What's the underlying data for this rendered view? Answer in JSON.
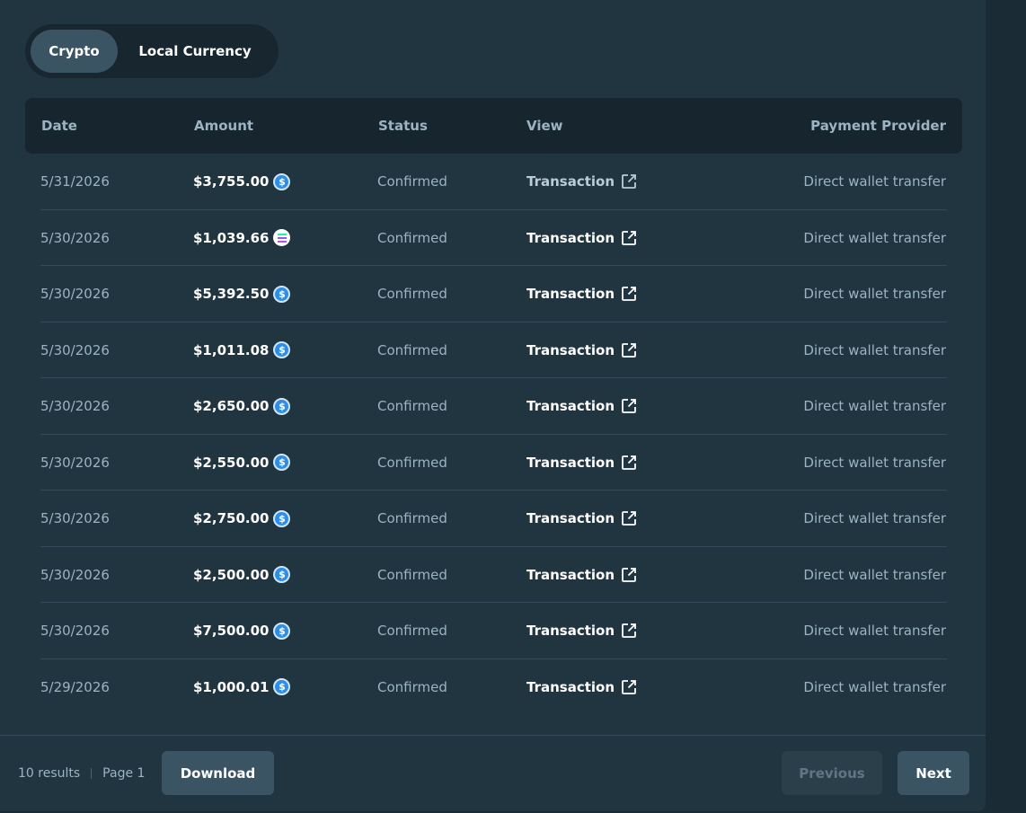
{
  "toggle": {
    "crypto_label": "Crypto",
    "local_label": "Local Currency"
  },
  "table": {
    "headers": {
      "date": "Date",
      "amount": "Amount",
      "status": "Status",
      "view": "View",
      "provider": "Payment Provider"
    },
    "rows": [
      {
        "date": "5/31/2026",
        "amount": "$3,755.00",
        "coin": "usdc-icon",
        "status": "Confirmed",
        "view": "Transaction",
        "provider": "Direct wallet transfer"
      },
      {
        "date": "5/30/2026",
        "amount": "$1,039.66",
        "coin": "solana-icon",
        "status": "Confirmed",
        "view": "Transaction",
        "provider": "Direct wallet transfer"
      },
      {
        "date": "5/30/2026",
        "amount": "$5,392.50",
        "coin": "usdc-icon",
        "status": "Confirmed",
        "view": "Transaction",
        "provider": "Direct wallet transfer"
      },
      {
        "date": "5/30/2026",
        "amount": "$1,011.08",
        "coin": "usdc-icon",
        "status": "Confirmed",
        "view": "Transaction",
        "provider": "Direct wallet transfer"
      },
      {
        "date": "5/30/2026",
        "amount": "$2,650.00",
        "coin": "usdc-icon",
        "status": "Confirmed",
        "view": "Transaction",
        "provider": "Direct wallet transfer"
      },
      {
        "date": "5/30/2026",
        "amount": "$2,550.00",
        "coin": "usdc-icon",
        "status": "Confirmed",
        "view": "Transaction",
        "provider": "Direct wallet transfer"
      },
      {
        "date": "5/30/2026",
        "amount": "$2,750.00",
        "coin": "usdc-icon",
        "status": "Confirmed",
        "view": "Transaction",
        "provider": "Direct wallet transfer"
      },
      {
        "date": "5/30/2026",
        "amount": "$2,500.00",
        "coin": "usdc-icon",
        "status": "Confirmed",
        "view": "Transaction",
        "provider": "Direct wallet transfer"
      },
      {
        "date": "5/30/2026",
        "amount": "$7,500.00",
        "coin": "usdc-icon",
        "status": "Confirmed",
        "view": "Transaction",
        "provider": "Direct wallet transfer"
      },
      {
        "date": "5/29/2026",
        "amount": "$1,000.01",
        "coin": "usdc-icon",
        "status": "Confirmed",
        "view": "Transaction",
        "provider": "Direct wallet transfer"
      }
    ]
  },
  "footer": {
    "results": "10 results",
    "page": "Page 1",
    "download_label": "Download",
    "previous_label": "Previous",
    "next_label": "Next"
  },
  "colors": {
    "panel_bg": "#213541",
    "header_bg": "#17252e",
    "accent_button": "#3b5464",
    "usdc_blue": "#2d8ee8",
    "muted_text": "#9ab4c2"
  }
}
